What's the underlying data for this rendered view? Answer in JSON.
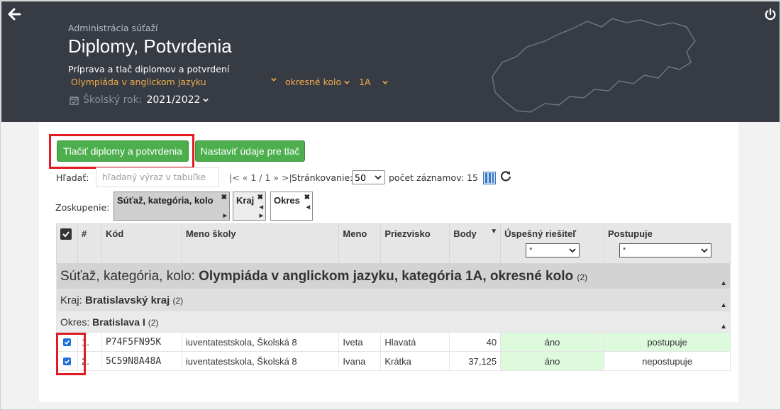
{
  "header": {
    "breadcrumb": "Administrácia súťaží",
    "title": "Diplomy, Potvrdenia",
    "subtitle": "Príprava a tlač diplomov a potvrdení",
    "competition": "Olympiáda v anglickom jazyku",
    "round": "okresné kolo",
    "category": "1A",
    "year_label": "Školský rok:",
    "year_value": "2021/2022"
  },
  "toolbar": {
    "print_label": "Tlačiť diplomy a potvrdenia",
    "settings_label": "Nastaviť údaje pre tlač"
  },
  "search": {
    "label": "Hľadať:",
    "placeholder": "hľadaný výraz v tabuľke"
  },
  "pager": {
    "first": "|<",
    "prev": "«",
    "info": "1 / 1",
    "next": "»",
    "last": ">|",
    "page_size_label": "Stránkovanie:",
    "page_size": "50",
    "count_label": "počet záznamov: 15"
  },
  "grouping": {
    "label": "Zoskupenie:",
    "chips": [
      "Súťaž, kategória, kolo",
      "Kraj",
      "Okres"
    ]
  },
  "table": {
    "columns": [
      "#",
      "Kód",
      "Meno školy",
      "Meno",
      "Priezvisko",
      "Body",
      "Úspešný riešiteľ",
      "Postupuje"
    ],
    "filter_success": "*",
    "filter_advance": "*",
    "group1_prefix": "Súťaž, kategória, kolo:",
    "group1_value": "Olympiáda v anglickom jazyku, kategória 1A, okresné kolo",
    "group1_count": "(2)",
    "group2_prefix": "Kraj:",
    "group2_value": "Bratislavský kraj",
    "group2_count": "(2)",
    "group3_prefix": "Okres:",
    "group3_value": "Bratislava I",
    "group3_count": "(2)",
    "rows": [
      {
        "num": "1.",
        "code": "P74F5FN95K",
        "school": "iuventatestskola, Školská 8",
        "first": "Iveta",
        "last": "Hlavatá",
        "points": "40",
        "success": "áno",
        "advance": "postupuje"
      },
      {
        "num": "2.",
        "code": "5C59N8A48A",
        "school": "iuventatestskola, Školská 8",
        "first": "Ivana",
        "last": "Krátka",
        "points": "37,125",
        "success": "áno",
        "advance": "nepostupuje"
      }
    ]
  },
  "colors": {
    "header_bg": "#373b43",
    "accent_orange": "#f0ad4e",
    "button_green": "#4cae4c",
    "highlight_red": "#e11b22",
    "success_green": "#ddfadd"
  }
}
